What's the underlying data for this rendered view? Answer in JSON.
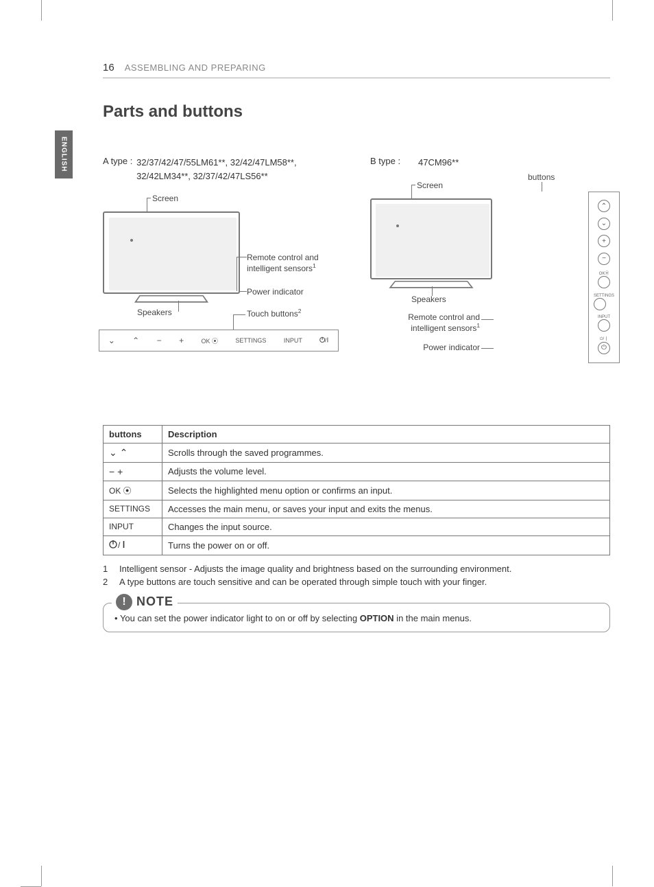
{
  "page": {
    "number": "16",
    "section": "ASSEMBLING AND PREPARING",
    "language_tab": "ENGLISH",
    "title": "Parts and buttons"
  },
  "types": {
    "a": {
      "label": "A type :",
      "models": "32/37/42/47/55LM61**, 32/42/47LM58**, 32/42LM34**, 32/37/42/47LS56**",
      "callouts": {
        "screen": "Screen",
        "remote_sensor": "Remote control and intelligent sensors",
        "remote_sensor_sup": "1",
        "power_indicator": "Power indicator",
        "speakers": "Speakers",
        "touch_buttons": "Touch buttons",
        "touch_buttons_sup": "2"
      },
      "button_panel": {
        "ok": "OK",
        "settings": "SETTINGS",
        "input": "INPUT"
      }
    },
    "b": {
      "label": "B type :",
      "models": "47CM96**",
      "callouts": {
        "screen": "Screen",
        "buttons": "buttons",
        "speakers": "Speakers",
        "remote_sensor": "Remote control and intelligent sensors",
        "remote_sensor_sup": "1",
        "power_indicator": "Power indicator"
      },
      "button_col": {
        "ok": "OK",
        "settings": "SETTINGS",
        "input": "INPUT"
      }
    }
  },
  "table": {
    "headers": {
      "buttons": "buttons",
      "description": "Description"
    },
    "rows": [
      {
        "btn_text": "",
        "btn_icon": "updown",
        "desc": "Scrolls through the saved programmes."
      },
      {
        "btn_text": "",
        "btn_icon": "minusplus",
        "desc": "Adjusts the volume level."
      },
      {
        "btn_text": "OK ⦿",
        "btn_icon": "",
        "desc": "Selects the highlighted menu option or confirms an input."
      },
      {
        "btn_text": "SETTINGS",
        "btn_icon": "",
        "desc": "Accesses the main menu, or saves your input and exits the menus."
      },
      {
        "btn_text": "INPUT",
        "btn_icon": "",
        "desc": "Changes the input source."
      },
      {
        "btn_text": "",
        "btn_icon": "power",
        "desc": "Turns the power on or off."
      }
    ]
  },
  "footnotes": [
    {
      "num": "1",
      "text": "Intelligent sensor - Adjusts the image quality and brightness based on the surrounding environment."
    },
    {
      "num": "2",
      "text": "A type buttons are touch sensitive and can be operated through simple touch with your finger."
    }
  ],
  "note": {
    "title": "NOTE",
    "body_pre": "You can set the power indicator light to on or off by selecting ",
    "body_bold": "OPTION",
    "body_post": " in the main menus."
  }
}
